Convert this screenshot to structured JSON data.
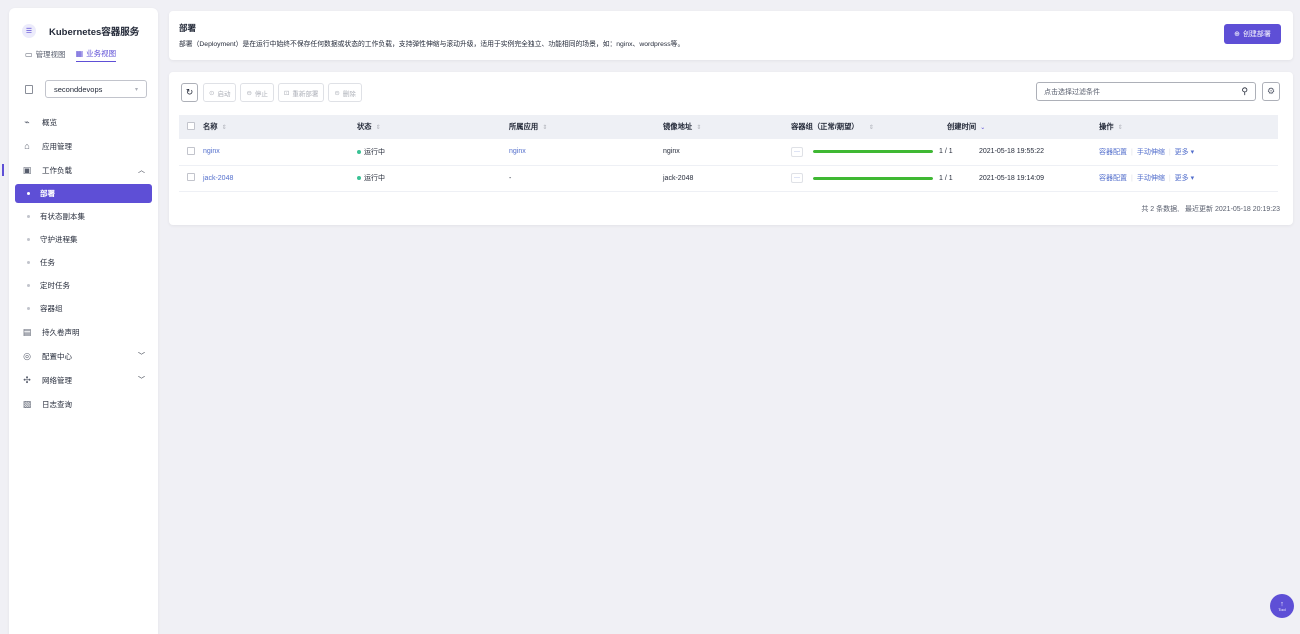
{
  "sidebar": {
    "title": "Kubernetes容器服务",
    "logo_glyph": "☰",
    "views": [
      {
        "label": "管理视图",
        "icon": "monitor-icon",
        "active": false
      },
      {
        "label": "业务视图",
        "icon": "dashboard-icon",
        "active": true
      }
    ],
    "namespace": "seconddevops",
    "menu": [
      {
        "label": "概览",
        "icon": "overview-icon"
      },
      {
        "label": "应用管理",
        "icon": "app-icon"
      },
      {
        "label": "工作负载",
        "icon": "workload-icon",
        "expanded": true
      }
    ],
    "sub_items": [
      {
        "label": "部署",
        "active": true
      },
      {
        "label": "有状态副本集"
      },
      {
        "label": "守护进程集"
      },
      {
        "label": "任务"
      },
      {
        "label": "定时任务"
      },
      {
        "label": "容器组"
      }
    ],
    "menu_bottom": [
      {
        "label": "持久卷声明",
        "icon": "storage-icon"
      },
      {
        "label": "配置中心",
        "icon": "config-icon",
        "has_chevron": true
      },
      {
        "label": "网络管理",
        "icon": "network-icon",
        "has_chevron": true
      },
      {
        "label": "日志查询",
        "icon": "log-icon"
      }
    ]
  },
  "header": {
    "title": "部署",
    "description": "部署（Deployment）是在运行中始终不保存任何数据或状态的工作负载，支持弹性伸缩与滚动升级，适用于实例完全独立、功能相同的场景，如：nginx、wordpress等。",
    "create_button": "创建部署"
  },
  "toolbar": {
    "start": "启动",
    "stop": "停止",
    "redeploy": "重新部署",
    "delete": "删除",
    "filter_placeholder": "点击选择过滤条件"
  },
  "table": {
    "columns": [
      "名称",
      "状态",
      "所属应用",
      "镜像地址",
      "容器组（正常/期望）",
      "创建时间",
      "操作"
    ],
    "rows": [
      {
        "name": "nginx",
        "status": "运行中",
        "app": "nginx",
        "app_link": true,
        "image": "nginx",
        "pods": "1 / 1",
        "pod_ratio": 1.0,
        "created": "2021-05-18 19:55:22"
      },
      {
        "name": "jack-2048",
        "status": "运行中",
        "app": "-",
        "app_link": false,
        "image": "jack-2048",
        "pods": "1 / 1",
        "pod_ratio": 1.0,
        "created": "2021-05-18 19:14:09"
      }
    ],
    "row_ops": [
      "容器配置",
      "手动伸缩",
      "更多"
    ]
  },
  "footer": {
    "count": "共 2 条数据,",
    "updated": "最近更新  2021-05-18 20:19:23"
  },
  "float_button": {
    "label": "Tool"
  },
  "colors": {
    "accent": "#5e4fd6",
    "link": "#526ecc",
    "progress": "#3fb833",
    "running": "#3ac295"
  }
}
